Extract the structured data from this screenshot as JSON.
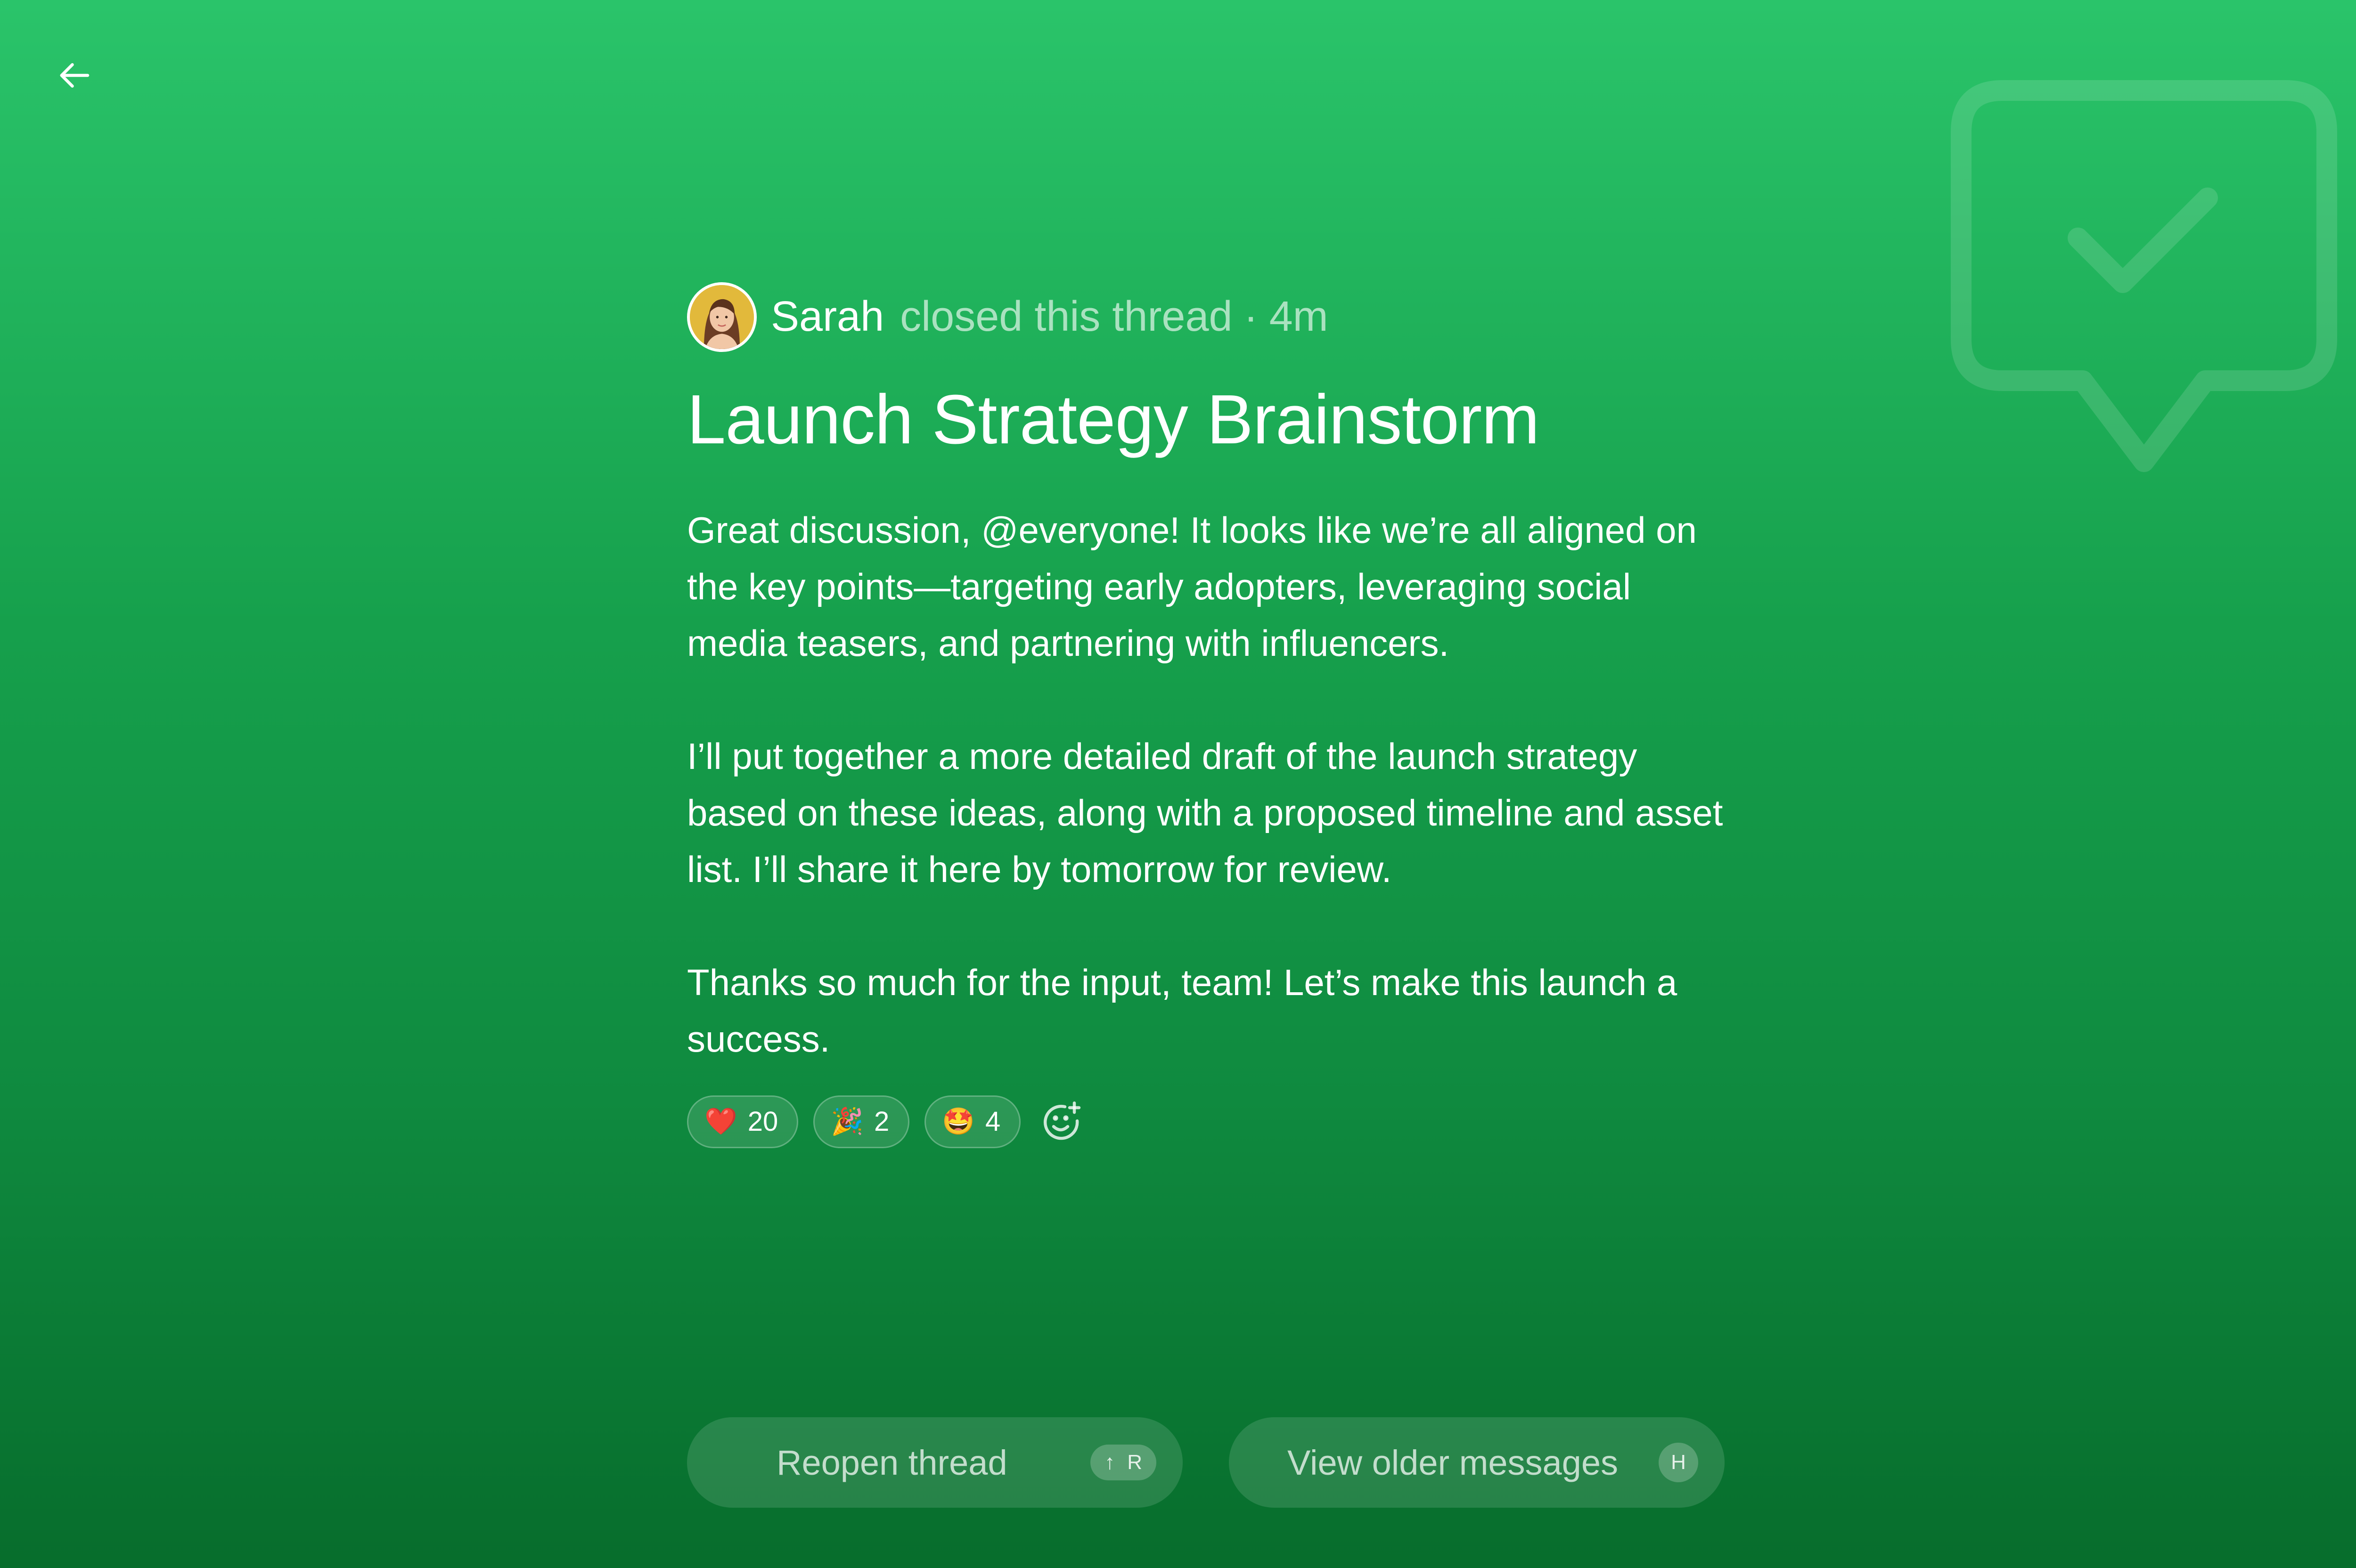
{
  "nav": {
    "back_icon": "arrow-left-icon"
  },
  "decor": {
    "background_icon": "chat-bubble-check-icon"
  },
  "event": {
    "user_name": "Sarah",
    "action": "closed this thread",
    "separator": "·",
    "time": "4m"
  },
  "thread": {
    "title": "Launch Strategy Brainstorm",
    "paragraphs": [
      "Great discussion, @everyone! It looks like we’re all aligned on the key points—targeting early adopters, leveraging social media teasers, and partnering with influencers.",
      "I’ll put together a more detailed draft of the launch strategy based on these ideas, along with a proposed timeline and asset list. I’ll share it here by tomorrow for review.",
      "Thanks so much for the input, team! Let’s make this launch a success."
    ]
  },
  "reactions": [
    {
      "emoji": "❤️",
      "count": "20",
      "icon": "heart-emoji"
    },
    {
      "emoji": "🎉",
      "count": "2",
      "icon": "party-popper-emoji"
    },
    {
      "emoji": "🤩",
      "count": "4",
      "icon": "star-struck-emoji"
    }
  ],
  "add_reaction_icon": "add-emoji-icon",
  "actions": {
    "reopen": {
      "label": "Reopen thread",
      "shortcut_arrow": "↑",
      "shortcut_key": "R"
    },
    "older": {
      "label": "View older messages",
      "shortcut_key": "H"
    }
  },
  "colors": {
    "gradient_top": "#2ac46a",
    "gradient_bottom": "#076d2c",
    "text": "#ffffff"
  }
}
